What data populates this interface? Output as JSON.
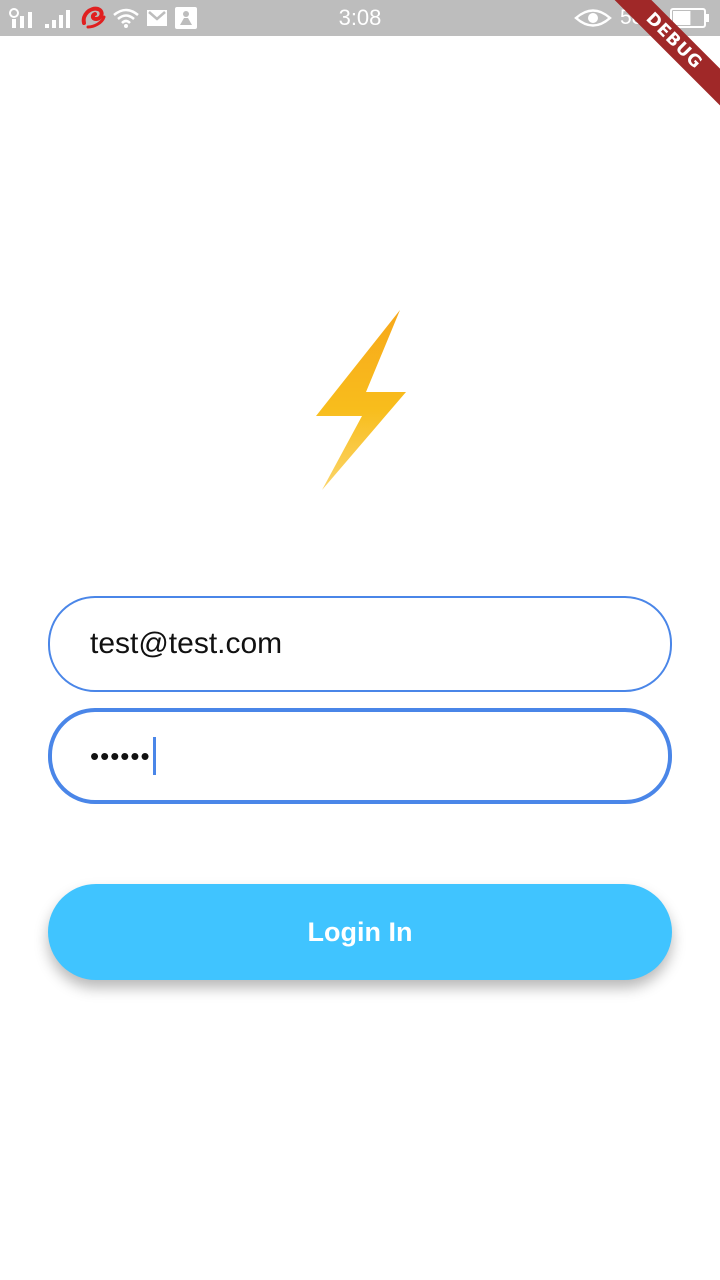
{
  "status_bar": {
    "time": "3:08",
    "battery_percent": "58%",
    "icons": [
      "signal-1-icon",
      "signal-2-icon",
      "carrier-logo-icon",
      "wifi-icon",
      "gmail-icon",
      "app-notification-icon",
      "eye-icon",
      "battery-icon"
    ],
    "battery_level": 0.58
  },
  "debug_banner": {
    "label": "DEBUG",
    "color": "#a02828"
  },
  "logo": {
    "icon": "lightning-bolt-icon",
    "colors": [
      "#f7a81b",
      "#fbd56b"
    ]
  },
  "login_form": {
    "email_value": "test@test.com",
    "password_value": "••••••",
    "login_label": "Login In"
  },
  "colors": {
    "accent": "#4a86e8",
    "button": "#40c4ff",
    "status_bar": "#bdbdbd"
  }
}
